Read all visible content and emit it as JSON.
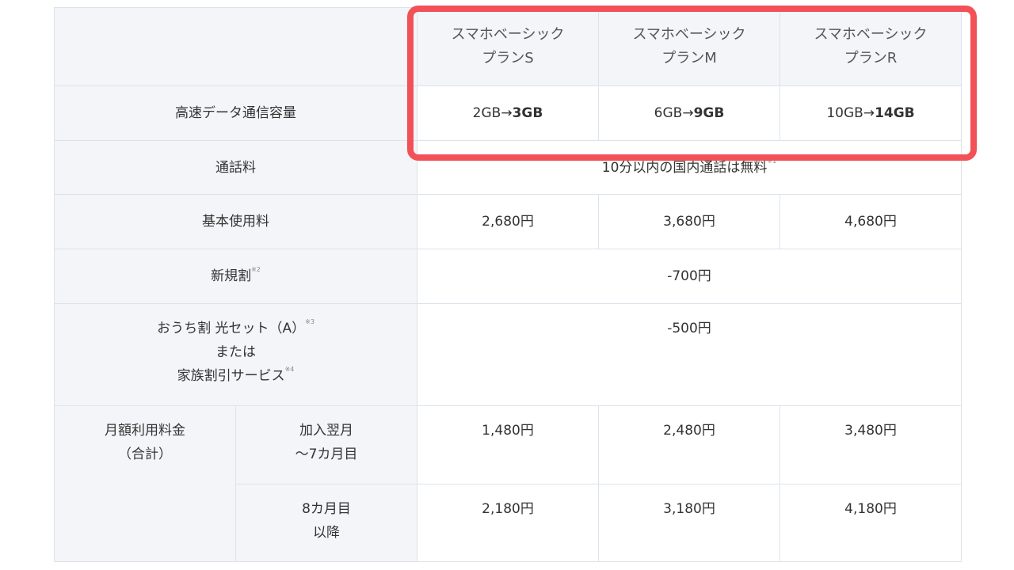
{
  "plans": [
    {
      "name_line1": "スマホベーシック",
      "name_line2": "プランS"
    },
    {
      "name_line1": "スマホベーシック",
      "name_line2": "プランM"
    },
    {
      "name_line1": "スマホベーシック",
      "name_line2": "プランR"
    }
  ],
  "data_capacity": {
    "label": "高速データ通信容量",
    "values": [
      {
        "from": "2GB→",
        "to": "3GB"
      },
      {
        "from": "6GB→",
        "to": "9GB"
      },
      {
        "from": "10GB→",
        "to": "14GB"
      }
    ]
  },
  "call_fee": {
    "label": "通話料",
    "value": "10分以内の国内通話は無料",
    "note": "※1"
  },
  "basic_fee": {
    "label": "基本使用料",
    "values": [
      "2,680円",
      "3,680円",
      "4,680円"
    ]
  },
  "new_discount": {
    "label": "新規割",
    "note": "※2",
    "value": "-700円"
  },
  "home_discount": {
    "line1": "おうち割 光セット（A）",
    "note1": "※3",
    "line2": "または",
    "line3": "家族割引サービス",
    "note2": "※4",
    "value": "-500円"
  },
  "monthly": {
    "label_line1": "月額利用料金",
    "label_line2": "（合計）",
    "periods": [
      {
        "line1": "加入翌月",
        "line2": "～7カ月目",
        "values": [
          "1,480円",
          "2,480円",
          "3,480円"
        ]
      },
      {
        "line1": "8カ月目",
        "line2": "以降",
        "values": [
          "2,180円",
          "3,180円",
          "4,180円"
        ]
      }
    ]
  },
  "colors": {
    "highlight": "#f25157",
    "header_bg": "#f3f5f8",
    "border": "#dde3ea"
  }
}
